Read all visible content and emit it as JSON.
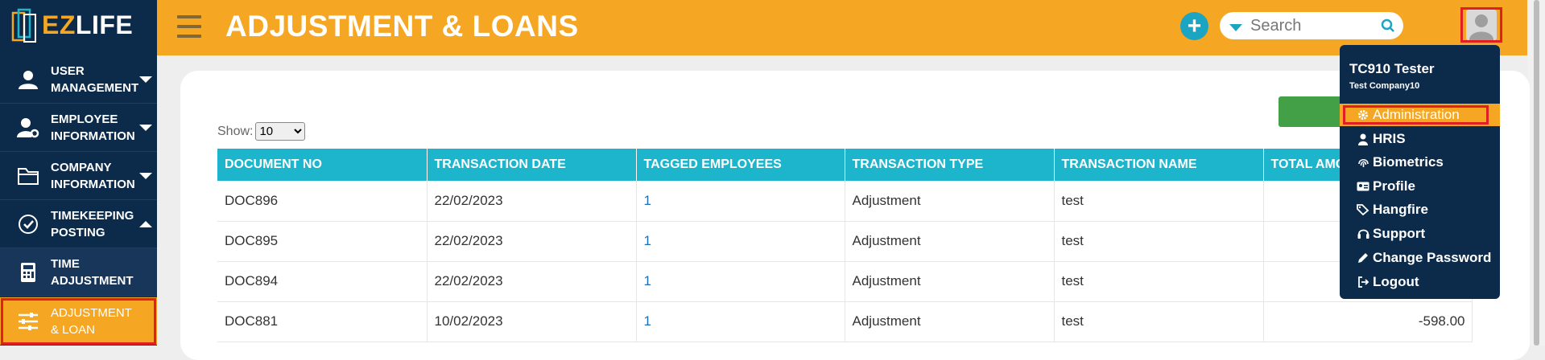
{
  "app": {
    "logo_ez": "EZ",
    "logo_life": "LIFE",
    "page_title": "ADJUSTMENT & LOANS"
  },
  "search": {
    "placeholder": "Search"
  },
  "sidebar": {
    "items": [
      {
        "label": "USER MANAGEMENT",
        "icon": "user-icon"
      },
      {
        "label": "EMPLOYEE INFORMATION",
        "icon": "user-gear-icon"
      },
      {
        "label": "COMPANY INFORMATION",
        "icon": "folder-icon"
      },
      {
        "label": "TIMEKEEPING POSTING",
        "icon": "check-circle-icon"
      },
      {
        "label": "TIME ADJUSTMENT",
        "icon": "calculator-icon"
      },
      {
        "label": "ADJUSTMENT & LOAN",
        "icon": "sliders-icon"
      }
    ]
  },
  "content": {
    "show_label": "Show:",
    "page_size": "10",
    "page_size_options": [
      "10"
    ],
    "columns": [
      "DOCUMENT NO",
      "TRANSACTION DATE",
      "TAGGED EMPLOYEES",
      "TRANSACTION TYPE",
      "TRANSACTION NAME",
      "TOTAL AMO"
    ],
    "rows": [
      {
        "doc": "DOC896",
        "date": "22/02/2023",
        "tagged": "1",
        "type": "Adjustment",
        "name": "test",
        "amount": ""
      },
      {
        "doc": "DOC895",
        "date": "22/02/2023",
        "tagged": "1",
        "type": "Adjustment",
        "name": "test",
        "amount": ""
      },
      {
        "doc": "DOC894",
        "date": "22/02/2023",
        "tagged": "1",
        "type": "Adjustment",
        "name": "test",
        "amount": ""
      },
      {
        "doc": "DOC881",
        "date": "10/02/2023",
        "tagged": "1",
        "type": "Adjustment",
        "name": "test",
        "amount": "-598.00"
      }
    ]
  },
  "user_menu": {
    "user_name": "TC910 Tester",
    "company": "Test Company10",
    "items": [
      {
        "label": "Administration",
        "icon": "gear-icon"
      },
      {
        "label": "HRIS",
        "icon": "user-icon"
      },
      {
        "label": "Biometrics",
        "icon": "fingerprint-icon"
      },
      {
        "label": "Profile",
        "icon": "id-card-icon"
      },
      {
        "label": "Hangfire",
        "icon": "tags-icon"
      },
      {
        "label": "Support",
        "icon": "headset-icon"
      },
      {
        "label": "Change Password",
        "icon": "pen-icon"
      },
      {
        "label": "Logout",
        "icon": "logout-icon"
      }
    ]
  },
  "colors": {
    "accent": "#f5a623",
    "sidebar": "#0c2b4b",
    "table_header": "#1cb5cc",
    "highlight": "#e02020"
  }
}
